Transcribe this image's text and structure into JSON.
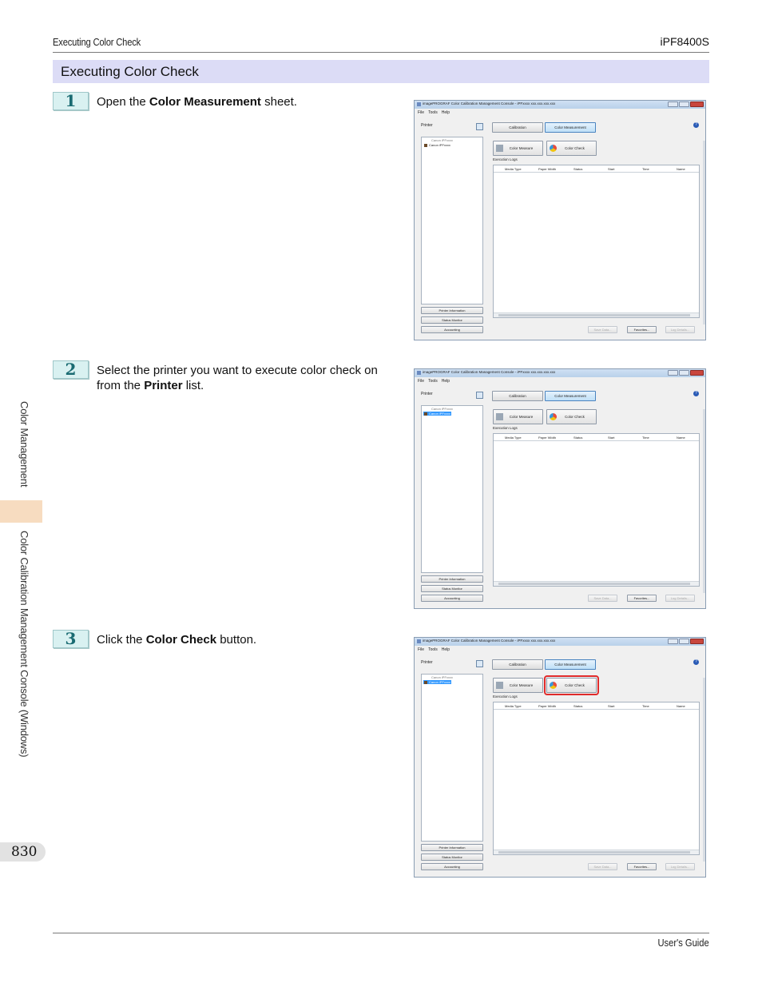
{
  "header": {
    "left": "Executing Color Check",
    "right": "iPF8400S"
  },
  "section": {
    "title": "Executing Color Check"
  },
  "steps": [
    {
      "num": "1",
      "pre": "Open the ",
      "bold": "Color Measurement",
      "post": " sheet."
    },
    {
      "num": "2",
      "pre": "Select the printer you want to execute color check on from the ",
      "bold": "Printer",
      "post": " list."
    },
    {
      "num": "3",
      "pre": "Click the ",
      "bold": "Color Check",
      "post": " button."
    }
  ],
  "screenshot": {
    "title": "imagePROGRAF Color Calibration Management Console - iPFxxxx xxx.xxx.xxx.xxx",
    "menu": [
      "File",
      "Tools",
      "Help"
    ],
    "printers_label": "Printer",
    "printer_group": "Canon iPFxxxx",
    "printer_item": "Canon iPFxxxx",
    "tabs": [
      "Calibration",
      "Color Measurement"
    ],
    "help": "?",
    "buttons": [
      "Color Measure",
      "Color Check"
    ],
    "exec_logs": "Execution Logs",
    "columns": [
      "Media Type",
      "Paper Width",
      "Status",
      "Start",
      "Time",
      "Name"
    ],
    "left_buttons": [
      "Printer Information",
      "Status Monitor",
      "Accounting"
    ],
    "right_buttons": [
      "Save Data...",
      "Favorites...",
      "Log Details..."
    ]
  },
  "sidebar": {
    "label1": "Color Management",
    "label2": "Color Calibration Management Console (Windows)"
  },
  "page_number": "830",
  "footer": {
    "right": "User's Guide"
  }
}
